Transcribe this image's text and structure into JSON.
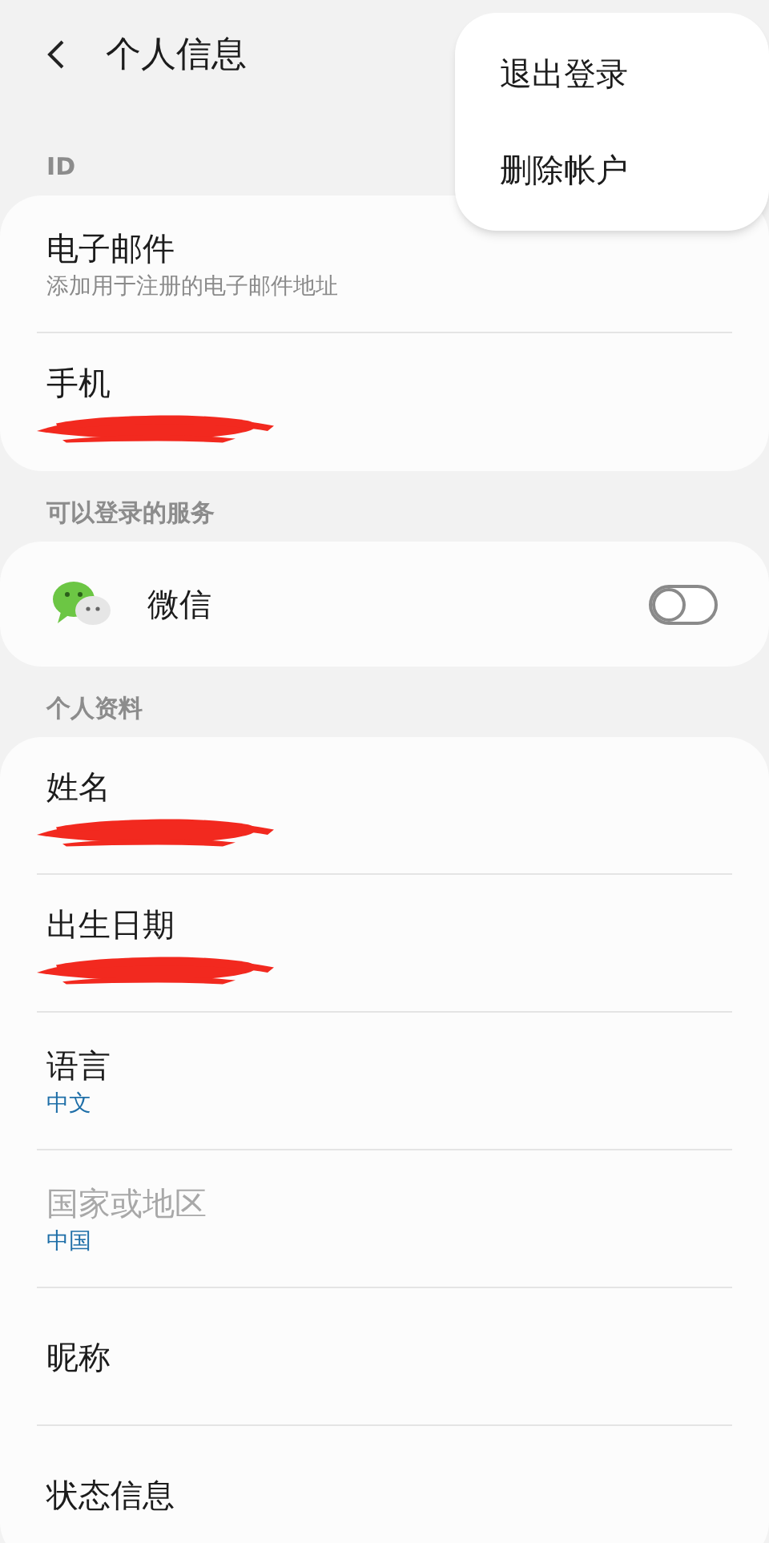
{
  "header": {
    "title": "个人信息"
  },
  "menu": {
    "items": [
      "退出登录",
      "删除帐户"
    ]
  },
  "sections": [
    {
      "label": "ID",
      "rows": [
        {
          "kind": "text",
          "title": "电子邮件",
          "subtitle": "添加用于注册的电子邮件地址",
          "disabled": false,
          "redacted": false
        },
        {
          "kind": "text",
          "title": "手机",
          "disabled": false,
          "redacted": true
        }
      ]
    },
    {
      "label": "可以登录的服务",
      "rows": [
        {
          "kind": "toggle",
          "title": "微信",
          "on": false
        }
      ]
    },
    {
      "label": "个人资料",
      "rows": [
        {
          "kind": "text",
          "title": "姓名",
          "disabled": false,
          "redacted": true
        },
        {
          "kind": "text",
          "title": "出生日期",
          "disabled": false,
          "redacted": true
        },
        {
          "kind": "text",
          "title": "语言",
          "value": "中文",
          "disabled": false,
          "redacted": false
        },
        {
          "kind": "text",
          "title": "国家或地区",
          "value": "中国",
          "disabled": true,
          "redacted": false
        },
        {
          "kind": "text",
          "title": "昵称",
          "disabled": false,
          "redacted": false
        },
        {
          "kind": "text",
          "title": "状态信息",
          "disabled": false,
          "redacted": false
        }
      ]
    }
  ]
}
